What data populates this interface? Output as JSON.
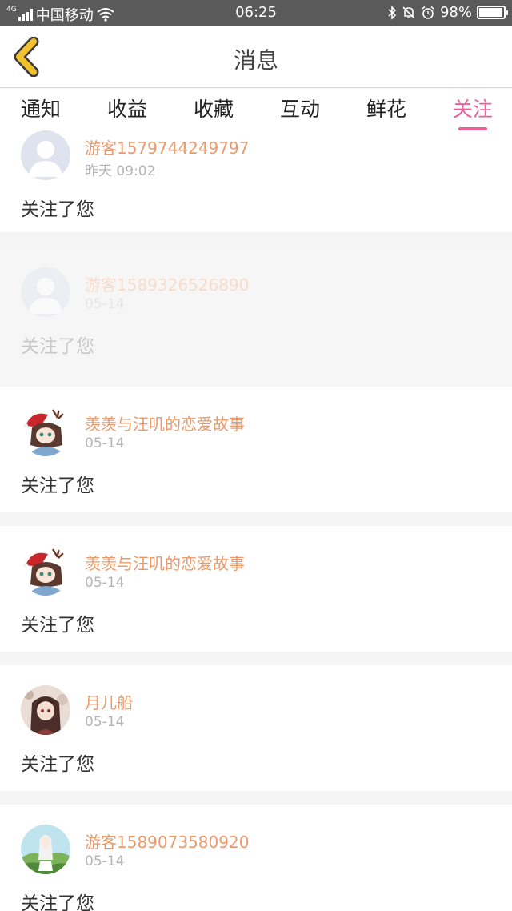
{
  "status_bar": {
    "network_tag": "4G",
    "carrier": "中国移动",
    "time": "06:25",
    "battery": "98%",
    "battery_level": 0.98,
    "icons": [
      "signal-icon",
      "wifi-icon",
      "bluetooth-icon",
      "mute-icon",
      "alarm-icon",
      "battery-icon"
    ]
  },
  "header": {
    "title": "消息",
    "back_icon": "chevron-left-icon",
    "back_color": "#f2c12e"
  },
  "tabs": [
    {
      "label": "通知",
      "active": false
    },
    {
      "label": "收益",
      "active": false
    },
    {
      "label": "收藏",
      "active": false
    },
    {
      "label": "互动",
      "active": false
    },
    {
      "label": "鲜花",
      "active": false
    },
    {
      "label": "关注",
      "active": true
    }
  ],
  "accent_color": "#ee5f98",
  "name_color": "#eb9a6b",
  "items": [
    {
      "name": "游客1579744249797",
      "time": "昨天 09:02",
      "message": "关注了您",
      "avatar": "default-avatar"
    },
    {
      "name": "游客1589326526890",
      "time": "05-14",
      "message": "关注了您",
      "avatar": "default-avatar"
    },
    {
      "name": "羡羡与汪叽的恋爱故事",
      "time": "05-14",
      "message": "关注了您",
      "avatar": "anime-avatar-christmas"
    },
    {
      "name": "羡羡与汪叽的恋爱故事",
      "time": "05-14",
      "message": "关注了您",
      "avatar": "anime-avatar-christmas"
    },
    {
      "name": "月儿船",
      "time": "05-14",
      "message": "关注了您",
      "avatar": "anime-avatar-girl"
    },
    {
      "name": "游客1589073580920",
      "time": "05-14",
      "message": "关注了您",
      "avatar": "anime-avatar-landscape"
    }
  ]
}
